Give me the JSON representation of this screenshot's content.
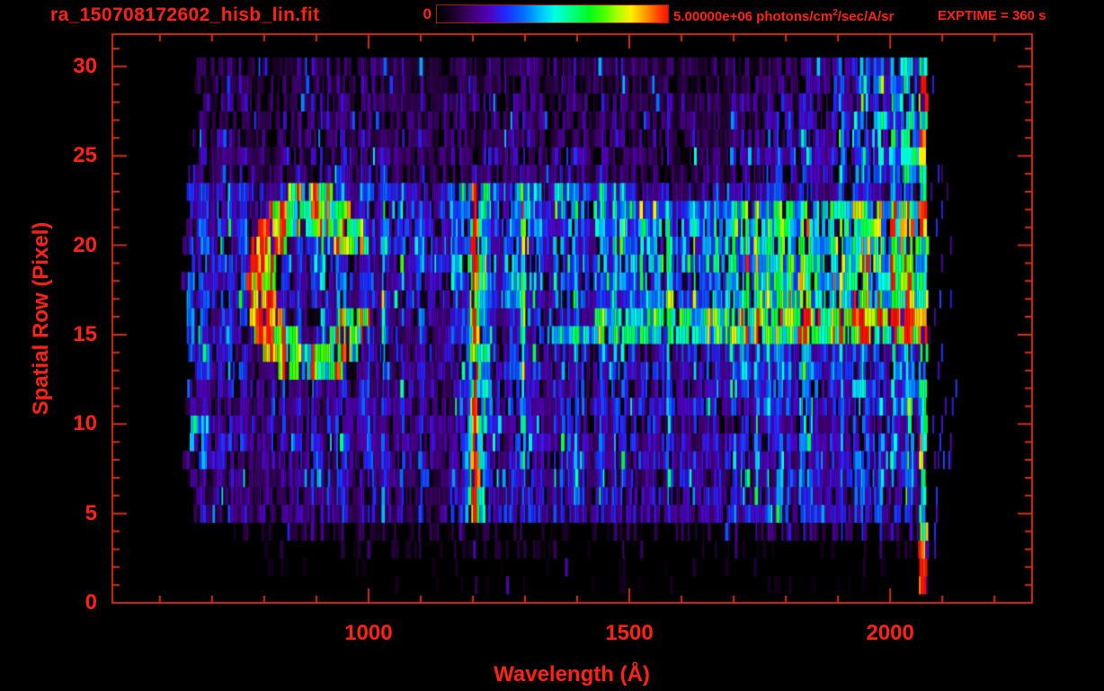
{
  "header": {
    "title": "ra_150708172602_hisb_lin.fit",
    "exptime": "EXPTIME = 360 s"
  },
  "colorbar": {
    "min_label": "0",
    "max_label_value": "5.00000e+06",
    "max_label_unit_prefix": " photons/cm",
    "max_label_unit_sup": "2",
    "max_label_unit_suffix": "/sec/A/sr"
  },
  "chart_data": {
    "type": "heatmap",
    "title": "ra_150708172602_hisb_lin.fit",
    "xlabel": "Wavelength (Å)",
    "ylabel": "Spatial Row (Pixel)",
    "xlim": [
      509,
      2272
    ],
    "ylim": [
      0,
      31.8
    ],
    "x_major_ticks": [
      1000,
      1500,
      2000
    ],
    "x_minor_tick_step": 100,
    "y_major_ticks": [
      0,
      5,
      10,
      15,
      20,
      25,
      30
    ],
    "y_minor_tick_step": 1,
    "colorbar_range_photons": [
      0,
      5000000
    ],
    "colorbar_units": "photons/cm^2/sec/A/sr",
    "exposure_time_s": 360,
    "colormap_stops": [
      [
        0.0,
        "#000000"
      ],
      [
        0.06,
        "#170021"
      ],
      [
        0.14,
        "#3c0068"
      ],
      [
        0.22,
        "#5000b8"
      ],
      [
        0.3,
        "#1c2bff"
      ],
      [
        0.38,
        "#0073ff"
      ],
      [
        0.45,
        "#00c3ff"
      ],
      [
        0.51,
        "#00ffe1"
      ],
      [
        0.58,
        "#00ff88"
      ],
      [
        0.66,
        "#00fb1e"
      ],
      [
        0.72,
        "#46ff00"
      ],
      [
        0.78,
        "#a8ff00"
      ],
      [
        0.84,
        "#fff000"
      ],
      [
        0.9,
        "#ff9d00"
      ],
      [
        0.95,
        "#ff4e00"
      ],
      [
        1.0,
        "#ff1000"
      ]
    ],
    "data_extent": {
      "wavelength_A": [
        650,
        2071
      ],
      "rows": [
        0,
        30
      ]
    },
    "row_noise_floor": [
      0,
      0.04,
      0.06,
      0.09,
      0.13,
      0.2,
      0.2,
      0.2,
      0.22,
      0.22,
      0.22,
      0.22,
      0.22,
      0.24,
      0.24,
      0.24,
      0.24,
      0.26,
      0.26,
      0.26,
      0.26,
      0.26,
      0.26,
      0.26,
      0.18,
      0.18,
      0.16,
      0.16,
      0.16,
      0.14,
      0.14
    ],
    "row_start_wavelength": {
      "rows_5_24": 653,
      "rows_25_30": 668,
      "row_4": 745,
      "row_3": 770,
      "row_2": 800,
      "row_1": 850,
      "row_0": 900
    },
    "bands": [
      {
        "name": "right-cyan-blue",
        "rows": [
          18,
          23
        ],
        "wavelength": [
          1060,
          1500
        ],
        "intensity": [
          0.3,
          0.38
        ]
      },
      {
        "name": "right-green-ramp",
        "rows": [
          17,
          22
        ],
        "wavelength": [
          1500,
          2055
        ],
        "intensity": [
          0.38,
          0.62
        ]
      },
      {
        "name": "row16-orange-ramp",
        "rows": [
          16,
          16
        ],
        "wavelength": [
          1430,
          2055
        ],
        "intensity": [
          0.45,
          0.93
        ]
      },
      {
        "name": "row15-yellow-ramp",
        "rows": [
          15,
          15
        ],
        "wavelength": [
          1330,
          2055
        ],
        "intensity": [
          0.42,
          0.78
        ]
      },
      {
        "name": "mid-blue",
        "rows": [
          11,
          14
        ],
        "wavelength": [
          1150,
          2055
        ],
        "intensity": [
          0.24,
          0.34
        ]
      },
      {
        "name": "low-blue",
        "rows": [
          5,
          9
        ],
        "wavelength": [
          1150,
          2055
        ],
        "intensity": [
          0.22,
          0.3
        ]
      },
      {
        "name": "upper-right-specks",
        "rows": [
          24,
          27
        ],
        "wavelength": [
          1750,
          2055
        ],
        "intensity": [
          0.2,
          0.42
        ]
      },
      {
        "name": "top-right-specks",
        "rows": [
          28,
          30
        ],
        "wavelength": [
          1800,
          2055
        ],
        "intensity": [
          0.18,
          0.4
        ]
      },
      {
        "name": "left-edge-cyan-blob",
        "rows": [
          8,
          10
        ],
        "wavelength": [
          650,
          710
        ],
        "intensity": [
          0.42,
          0.3
        ]
      },
      {
        "name": "left-blue",
        "rows": [
          13,
          23
        ],
        "wavelength": [
          650,
          770
        ],
        "intensity": [
          0.28,
          0.28
        ]
      },
      {
        "name": "row4-right",
        "rows": [
          4,
          4
        ],
        "wavelength": [
          1700,
          2055
        ],
        "intensity": [
          0.15,
          0.25
        ]
      }
    ],
    "ring_feature": {
      "center_wavelength": 888,
      "center_row": 17.8,
      "outer_radius_wavelength": 122,
      "outer_radius_rows": 5.4,
      "inner_fraction": 0.55,
      "intensity": 0.62,
      "left_edge_boost": 0.6,
      "gap": {
        "rows": [
          16.3,
          19.3
        ],
        "wavelength_min": 935
      }
    },
    "emission_lines": [
      {
        "wavelength": 1032,
        "sigma": 7,
        "rows": [
          13,
          24
        ],
        "peak": 0.52
      },
      {
        "wavelength": 1032,
        "sigma": 7,
        "rows": [
          5,
          9
        ],
        "peak": 0.33
      },
      {
        "wavelength": 1207,
        "sigma": 16,
        "rows": [
          5,
          23
        ],
        "peak": 0.78
      },
      {
        "wavelength": 1205,
        "sigma": 9,
        "rows": [
          19,
          23
        ],
        "peak": 0.97
      },
      {
        "wavelength": 1205,
        "sigma": 9,
        "rows": [
          6,
          10
        ],
        "peak": 0.97
      },
      {
        "wavelength": 1205,
        "sigma": 7,
        "rows": [
          0,
          4
        ],
        "peak": 0.14
      },
      {
        "wavelength": 1207,
        "sigma": 10,
        "rows": [
          24,
          24
        ],
        "peak": 0.3
      },
      {
        "wavelength": 915,
        "sigma": 6,
        "rows": [
          16,
          20
        ],
        "peak": 0.5
      },
      {
        "wavelength": 1297,
        "sigma": 8,
        "rows": [
          15,
          23
        ],
        "peak": 0.5
      },
      {
        "wavelength": 1297,
        "sigma": 8,
        "rows": [
          8,
          14
        ],
        "peak": 0.4
      },
      {
        "wavelength": 1400,
        "sigma": 7,
        "rows": [
          6,
          22
        ],
        "peak": 0.33
      },
      {
        "wavelength": 1468,
        "sigma": 7,
        "rows": [
          15,
          22
        ],
        "peak": 0.42
      }
    ],
    "right_edge_column": {
      "wavelength": [
        2056,
        2071
      ],
      "rows": [
        1,
        30
      ],
      "base_intensity": 0.6,
      "hot_intensity": 0.95,
      "hot_rows": [
        [
          1,
          3
        ],
        [
          8,
          8
        ],
        [
          15,
          16
        ],
        [
          21,
          22
        ],
        [
          25,
          26
        ],
        [
          28,
          29
        ]
      ]
    },
    "beyond_edge_specks": {
      "wavelength": [
        2074,
        2128
      ],
      "rows": [
        3,
        30
      ],
      "intensity": [
        0.12,
        0.37
      ],
      "density": 0.05
    }
  },
  "colors": {
    "background": "#000000",
    "label_red": "#ff2213",
    "frame_red": "#d62e14",
    "colorbar_border": "#9a2211"
  }
}
